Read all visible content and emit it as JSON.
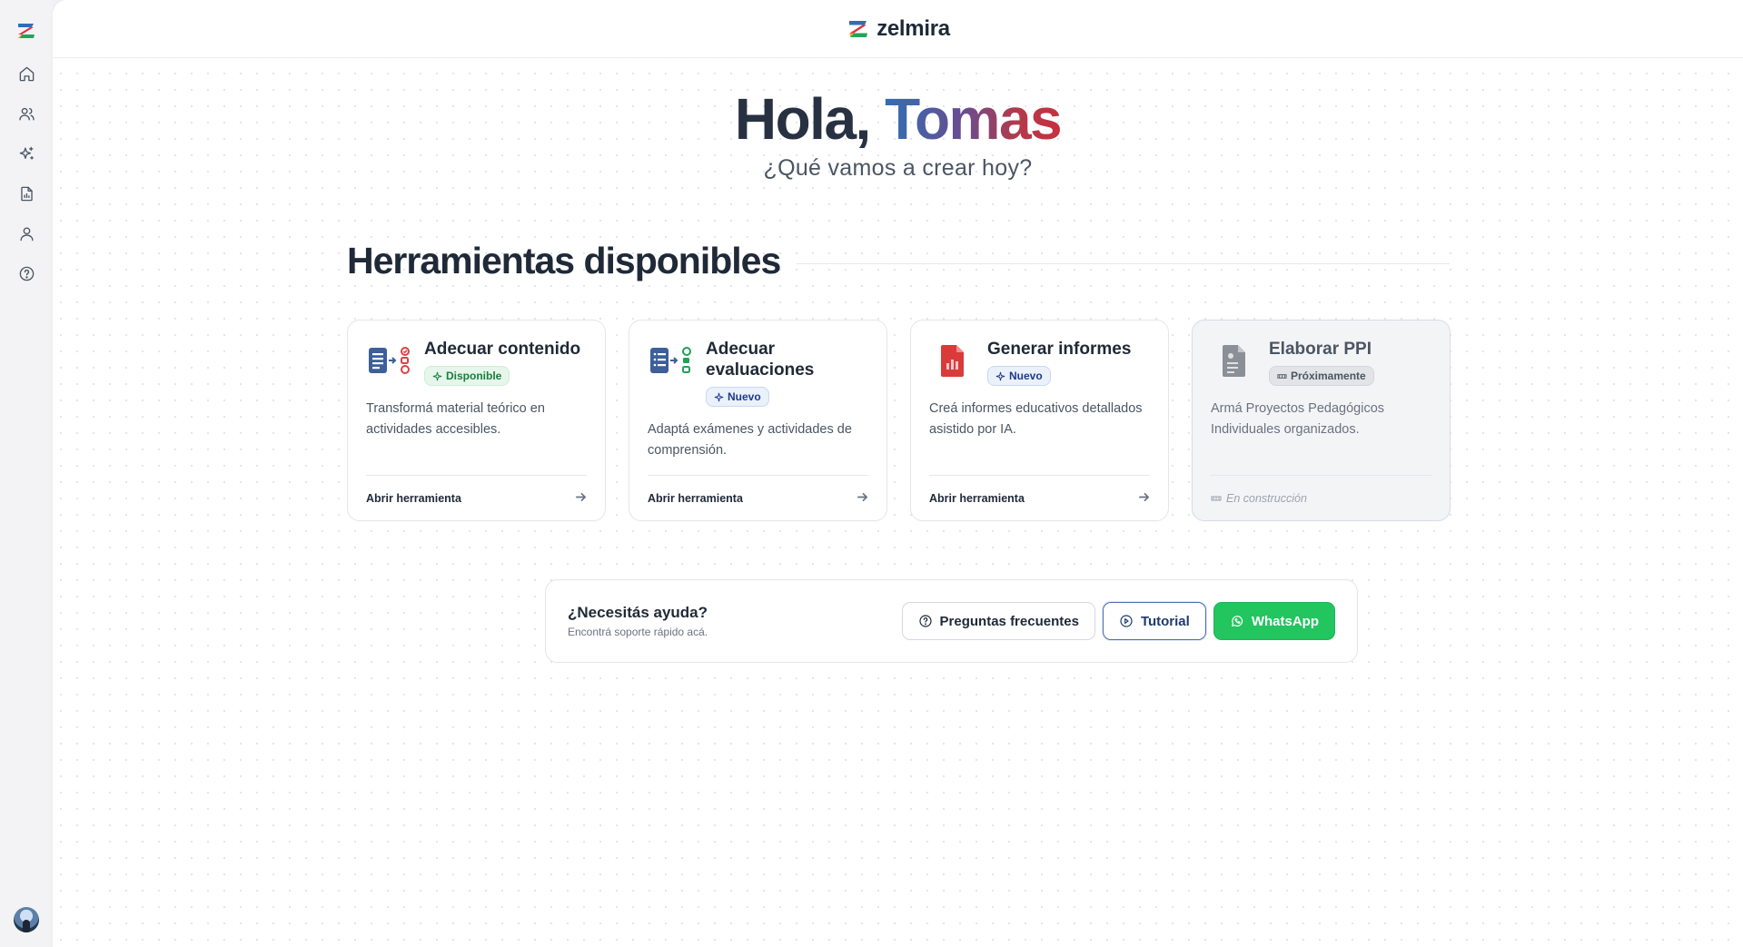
{
  "app": {
    "brand": "zelmira"
  },
  "sidebar": {
    "items": [
      {
        "name": "home",
        "icon": "home-icon"
      },
      {
        "name": "users",
        "icon": "users-icon"
      },
      {
        "name": "tools",
        "icon": "sparkles-icon"
      },
      {
        "name": "reports",
        "icon": "report-icon"
      },
      {
        "name": "profile",
        "icon": "user-icon"
      },
      {
        "name": "help",
        "icon": "help-circle-icon"
      }
    ]
  },
  "hero": {
    "greeting_prefix": "Hola, ",
    "user_name": "Tomas",
    "subtitle": "¿Qué vamos a crear hoy?"
  },
  "tools_section": {
    "title": "Herramientas disponibles",
    "cards": [
      {
        "title": "Adecuar contenido",
        "badge": "Disponible",
        "badge_color": "#15803d",
        "description": "Transformá material teórico en actividades accesibles.",
        "action": "Abrir herramienta",
        "icon": "content-adapt-icon"
      },
      {
        "title": "Adecuar evaluaciones",
        "badge": "Nuevo",
        "badge_color": "#1e3a8a",
        "description": "Adaptá exámenes y actividades de comprensión.",
        "action": "Abrir herramienta",
        "icon": "evaluation-adapt-icon"
      },
      {
        "title": "Generar informes",
        "badge": "Nuevo",
        "badge_color": "#1e3a8a",
        "description": "Creá informes educativos detallados asistido por IA.",
        "action": "Abrir herramienta",
        "icon": "report-document-icon"
      },
      {
        "title": "Elaborar PPI",
        "badge": "Próximamente",
        "badge_color": "#4b5563",
        "description": "Armá Proyectos Pedagógicos Individuales organizados.",
        "action": "En construcción",
        "icon": "ppi-document-icon"
      }
    ]
  },
  "help": {
    "title": "¿Necesitás ayuda?",
    "subtitle": "Encontrá soporte rápido acá.",
    "faq_label": "Preguntas frecuentes",
    "tutorial_label": "Tutorial",
    "whatsapp_label": "WhatsApp",
    "whatsapp_color": "#22c55e"
  }
}
